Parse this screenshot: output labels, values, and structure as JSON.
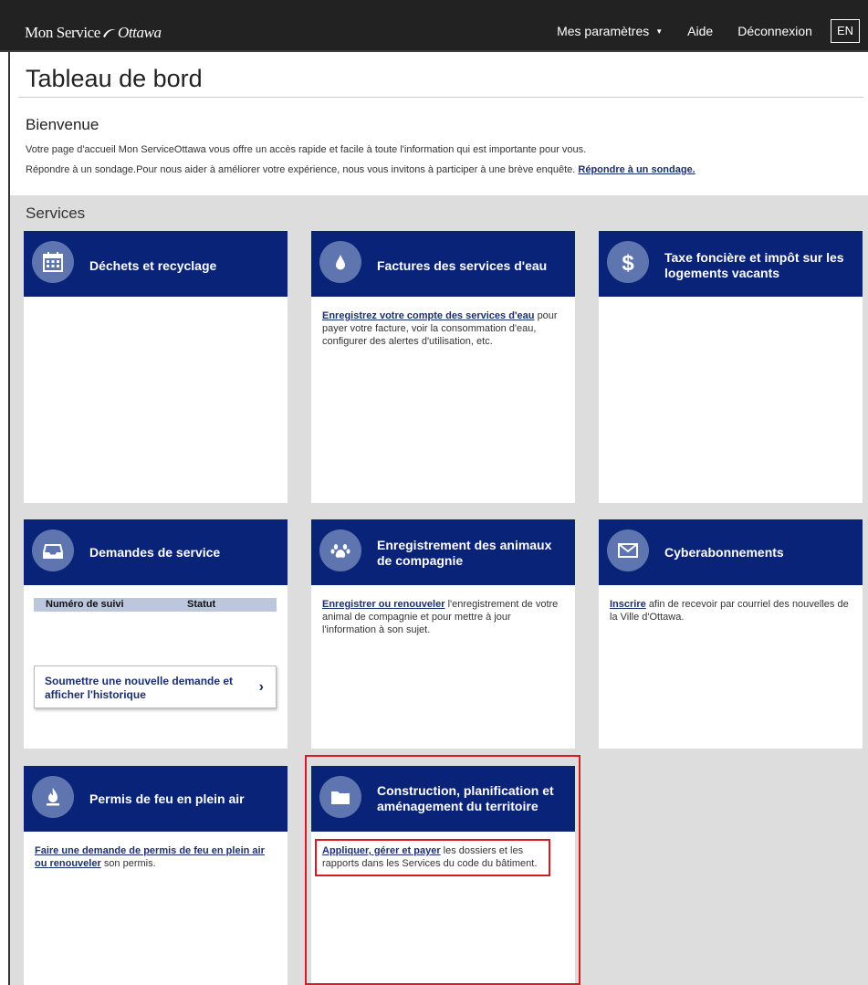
{
  "header": {
    "logo": {
      "mon": "Mon",
      "service": "Service",
      "ottawa": "Ottawa"
    },
    "nav": {
      "settings": "Mes paramètres",
      "help": "Aide",
      "logout": "Déconnexion",
      "lang": "EN"
    }
  },
  "page": {
    "title": "Tableau de bord",
    "welcome": "Bienvenue",
    "intro": "Votre page d'accueil Mon ServiceOttawa vous offre un accès rapide et facile à toute l'information qui est importante pour vous.",
    "survey_text": "Répondre à un sondage.Pour nous aider à améliorer votre expérience, nous vous invitons à participer à une brève enquête.",
    "survey_link": "Répondre à un sondage.",
    "services_heading": "Services"
  },
  "cards": {
    "waste": {
      "title": "Déchets et recyclage",
      "icon": "calendar-icon"
    },
    "water": {
      "title": "Factures des services d'eau",
      "icon": "water-drop-icon",
      "link": "Enregistrez votre compte des services d'eau",
      "text": "pour payer votre facture, voir la consommation d'eau, configurer des alertes d'utilisation, etc."
    },
    "tax": {
      "title": "Taxe foncière et impôt sur les logements vacants",
      "icon": "dollar-icon"
    },
    "requests": {
      "title": "Demandes de service",
      "icon": "inbox-icon",
      "col1": "Numéro de suivi",
      "col2": "Statut",
      "button": "Soumettre une nouvelle demande et afficher l'historique"
    },
    "pets": {
      "title": "Enregistrement des animaux de compagnie",
      "icon": "paw-icon",
      "link": "Enregistrer ou renouveler",
      "text": "l'enregistrement de votre animal de compagnie et pour mettre à jour l'information à son sujet."
    },
    "subs": {
      "title": "Cyberabonnements",
      "icon": "envelope-icon",
      "link": "Inscrire",
      "text": "afin de recevoir par courriel des nouvelles de la Ville d'Ottawa."
    },
    "fire": {
      "title": "Permis de feu en plein air",
      "icon": "flame-icon",
      "link": "Faire une demande de permis de feu en plein air ou renouveler",
      "text": "son permis."
    },
    "construction": {
      "title": "Construction, planification et aménagement du territoire",
      "icon": "folder-icon",
      "link": "Appliquer, gérer et payer",
      "text": "les dossiers et les rapports dans les Services du code du bâtiment."
    }
  },
  "colors": {
    "header_bg": "#222222",
    "card_header": "#082377",
    "icon_circle": "#5f75b0",
    "highlight": "#d71920",
    "link": "#1c2f6e"
  }
}
